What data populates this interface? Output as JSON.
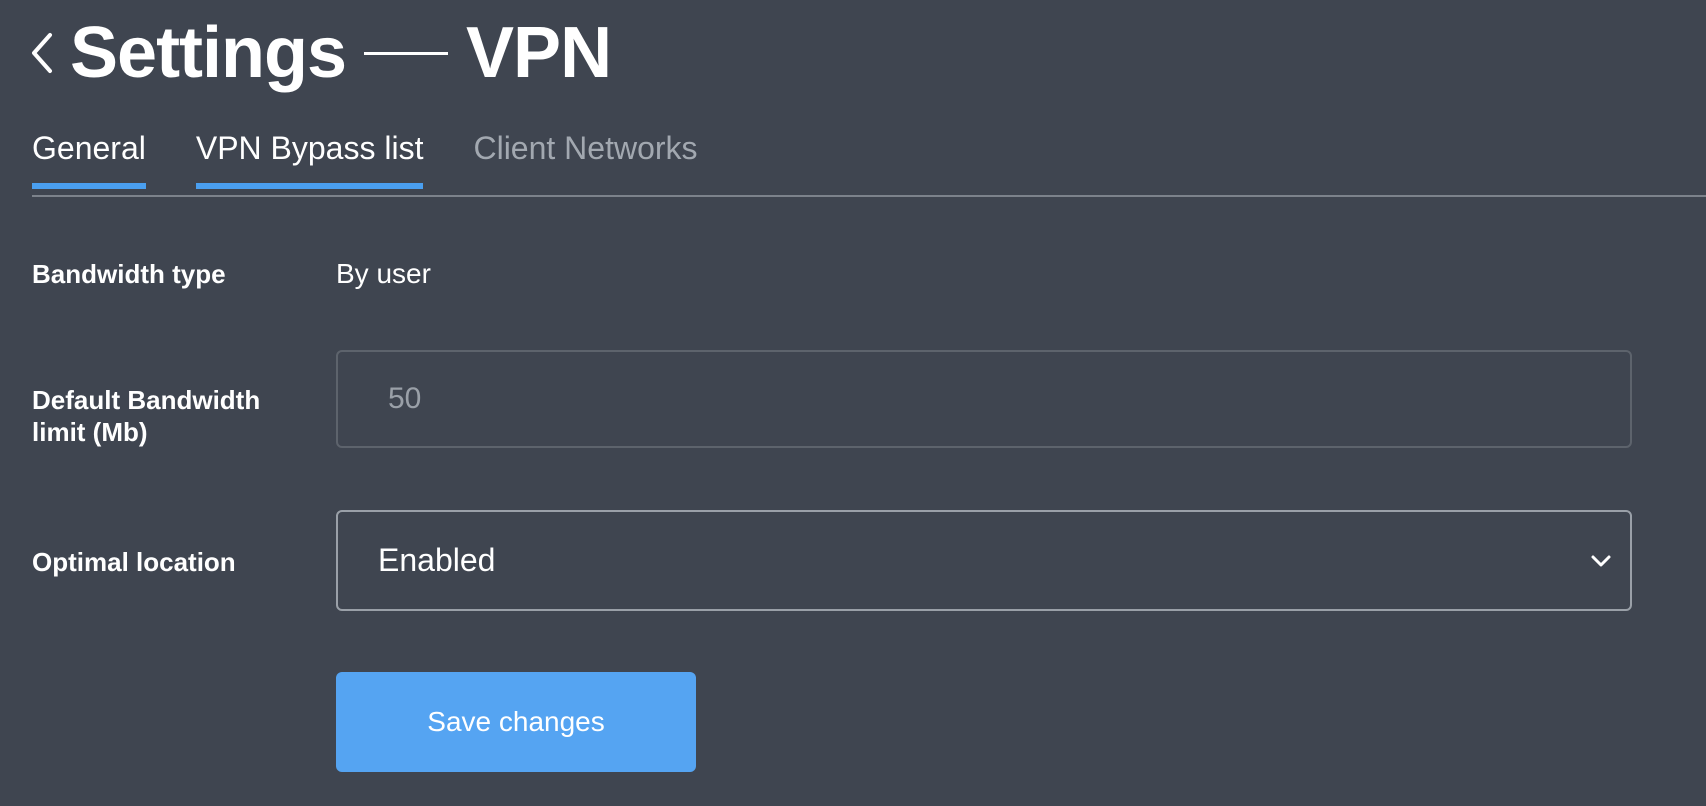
{
  "header": {
    "title_left": "Settings",
    "title_right": "VPN",
    "back_icon": "chevron-left-icon"
  },
  "tabs": [
    {
      "label": "General",
      "state": "active"
    },
    {
      "label": "VPN Bypass list",
      "state": "active"
    },
    {
      "label": "Client Networks",
      "state": "inactive"
    }
  ],
  "form": {
    "bandwidth_type": {
      "label": "Bandwidth type",
      "value": "By user"
    },
    "default_bandwidth_limit": {
      "label_line1": "Default Bandwidth",
      "label_line2": "limit (Mb)",
      "placeholder": "50",
      "value": ""
    },
    "optimal_location": {
      "label": "Optimal location",
      "selected": "Enabled",
      "icon": "chevron-down-icon"
    },
    "save_label": "Save changes"
  },
  "colors": {
    "background": "#3f4550",
    "accent": "#4a9ff0",
    "button": "#55a4f2",
    "inactive_tab": "#a2a8b0"
  }
}
